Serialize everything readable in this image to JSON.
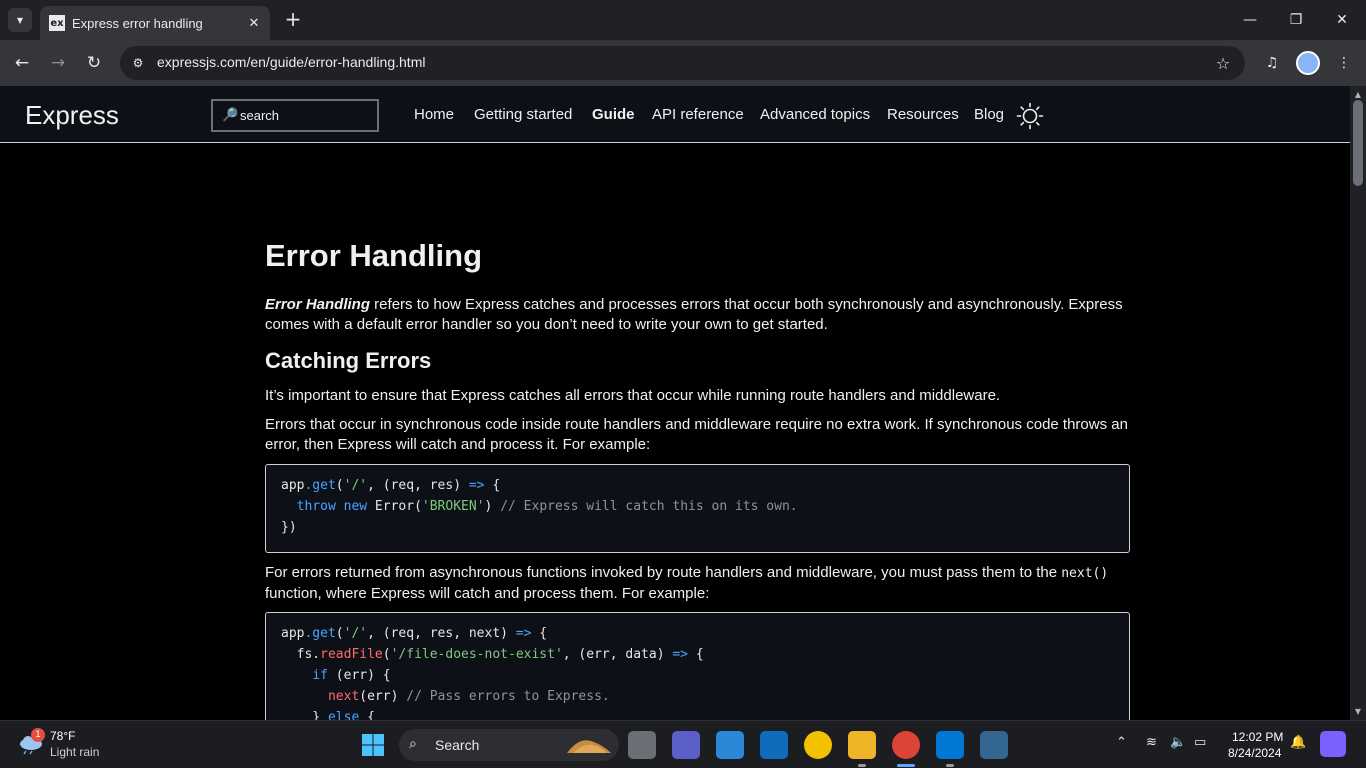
{
  "browser": {
    "tab_title": "Express error handling",
    "tab_favicon_text": "ex",
    "url": "expressjs.com/en/guide/error-handling.html"
  },
  "site": {
    "logo": "Express",
    "search_placeholder": "search",
    "nav": [
      "Home",
      "Getting started",
      "Guide",
      "API reference",
      "Advanced topics",
      "Resources",
      "Blog"
    ],
    "active_nav": "Guide"
  },
  "article": {
    "title": "Error Handling",
    "intro_em": "Error Handling",
    "intro_rest": " refers to how Express catches and processes errors that occur both synchronously and asynchronously. Express comes with a default error handler so you don’t need to write your own to get started.",
    "h2": "Catching Errors",
    "p1": "It’s important to ensure that Express catches all errors that occur while running route handlers and middleware.",
    "p2": "Errors that occur in synchronous code inside route handlers and middleware require no extra work. If synchronous code throws an error, then Express will catch and process it. For example:",
    "p3_before": "For errors returned from asynchronous functions invoked by route handlers and middleware, you must pass them to the ",
    "p3_code": "next()",
    "p3_after": " function, where Express will catch and process them. For example:"
  },
  "taskbar": {
    "weather_temp": "78°F",
    "weather_desc": "Light rain",
    "weather_badge": "1",
    "search_label": "Search",
    "time": "12:02 PM",
    "date": "8/24/2024"
  },
  "colors": {
    "accent": "#4aa3ff",
    "string": "#7ec97e",
    "comment": "#8b949e",
    "function": "#ff6b6b"
  }
}
